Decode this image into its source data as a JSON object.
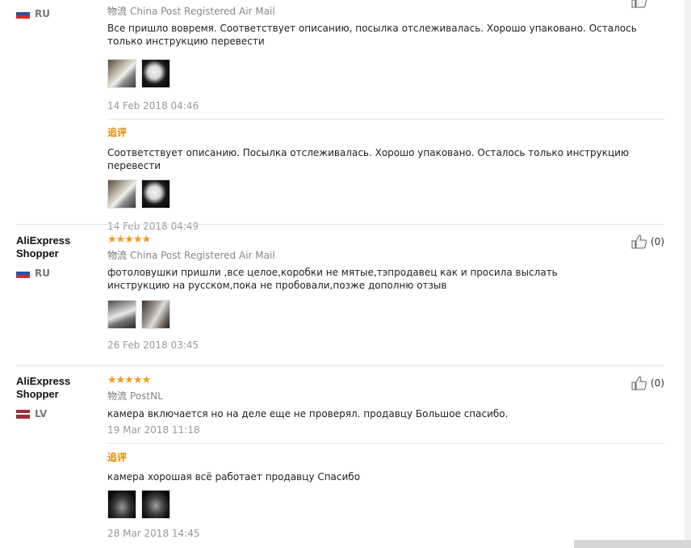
{
  "reviews": [
    {
      "country": "RU",
      "logistics_tag": "物流",
      "logistics": "China Post Registered Air Mail",
      "text": "Все пришло вовремя. Соответствует описанию, посылка отслеживалась. Хорошо упаковано. Осталось только инструкцию перевести",
      "date": "14 Feb 2018 04:46",
      "followup_label": "追评",
      "followup_text": "Соответствует описанию. Посылка отслеживалась. Хорошо упаковано. Осталось только инструкцию перевести",
      "followup_date": "14 Feb 2018 04:49"
    },
    {
      "user": "AliExpress Shopper",
      "country": "RU",
      "stars": "★★★★★",
      "helpful": "(0)",
      "logistics_tag": "物流",
      "logistics": "China Post Registered Air Mail",
      "text": "фотоловушки пришли ,все целое,коробки не мятые,тэпродавец как и просила выслать инструкцию на русском,пока не пробовали,позже дополню отзыв",
      "date": "26 Feb 2018 03:45"
    },
    {
      "user": "AliExpress Shopper",
      "country": "LV",
      "stars": "★★★★★",
      "helpful": "(0)",
      "logistics_tag": "物流",
      "logistics": "PostNL",
      "text": "камера включается но на деле еще не проверял. продавцу Большое спасибо.",
      "date": "19 Mar 2018 11:18",
      "followup_label": "追评",
      "followup_text": "камера хорошая всё работает продавцу Спасибо",
      "followup_date": "28 Mar 2018 14:45"
    }
  ],
  "colors": {
    "star": "#f29b1d",
    "followup": "#e58a00"
  }
}
